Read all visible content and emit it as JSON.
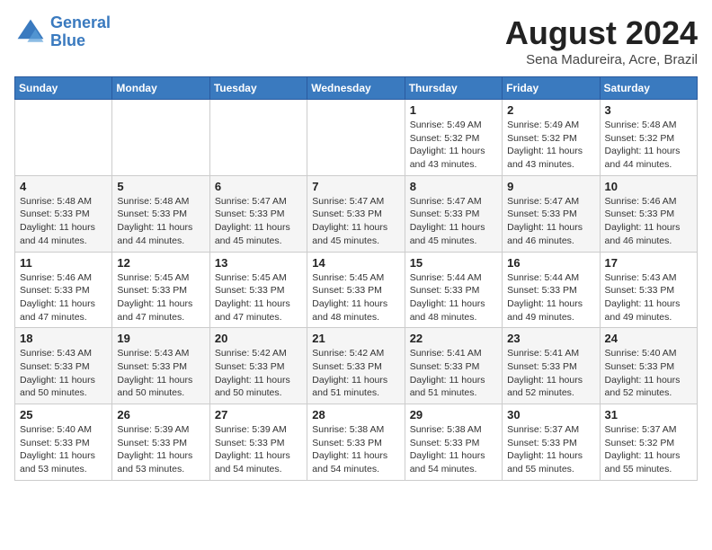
{
  "logo": {
    "line1": "General",
    "line2": "Blue"
  },
  "title": "August 2024",
  "location": "Sena Madureira, Acre, Brazil",
  "days_of_week": [
    "Sunday",
    "Monday",
    "Tuesday",
    "Wednesday",
    "Thursday",
    "Friday",
    "Saturday"
  ],
  "weeks": [
    [
      {
        "day": "",
        "info": ""
      },
      {
        "day": "",
        "info": ""
      },
      {
        "day": "",
        "info": ""
      },
      {
        "day": "",
        "info": ""
      },
      {
        "day": "1",
        "info": "Sunrise: 5:49 AM\nSunset: 5:32 PM\nDaylight: 11 hours and 43 minutes."
      },
      {
        "day": "2",
        "info": "Sunrise: 5:49 AM\nSunset: 5:32 PM\nDaylight: 11 hours and 43 minutes."
      },
      {
        "day": "3",
        "info": "Sunrise: 5:48 AM\nSunset: 5:32 PM\nDaylight: 11 hours and 44 minutes."
      }
    ],
    [
      {
        "day": "4",
        "info": "Sunrise: 5:48 AM\nSunset: 5:33 PM\nDaylight: 11 hours and 44 minutes."
      },
      {
        "day": "5",
        "info": "Sunrise: 5:48 AM\nSunset: 5:33 PM\nDaylight: 11 hours and 44 minutes."
      },
      {
        "day": "6",
        "info": "Sunrise: 5:47 AM\nSunset: 5:33 PM\nDaylight: 11 hours and 45 minutes."
      },
      {
        "day": "7",
        "info": "Sunrise: 5:47 AM\nSunset: 5:33 PM\nDaylight: 11 hours and 45 minutes."
      },
      {
        "day": "8",
        "info": "Sunrise: 5:47 AM\nSunset: 5:33 PM\nDaylight: 11 hours and 45 minutes."
      },
      {
        "day": "9",
        "info": "Sunrise: 5:47 AM\nSunset: 5:33 PM\nDaylight: 11 hours and 46 minutes."
      },
      {
        "day": "10",
        "info": "Sunrise: 5:46 AM\nSunset: 5:33 PM\nDaylight: 11 hours and 46 minutes."
      }
    ],
    [
      {
        "day": "11",
        "info": "Sunrise: 5:46 AM\nSunset: 5:33 PM\nDaylight: 11 hours and 47 minutes."
      },
      {
        "day": "12",
        "info": "Sunrise: 5:45 AM\nSunset: 5:33 PM\nDaylight: 11 hours and 47 minutes."
      },
      {
        "day": "13",
        "info": "Sunrise: 5:45 AM\nSunset: 5:33 PM\nDaylight: 11 hours and 47 minutes."
      },
      {
        "day": "14",
        "info": "Sunrise: 5:45 AM\nSunset: 5:33 PM\nDaylight: 11 hours and 48 minutes."
      },
      {
        "day": "15",
        "info": "Sunrise: 5:44 AM\nSunset: 5:33 PM\nDaylight: 11 hours and 48 minutes."
      },
      {
        "day": "16",
        "info": "Sunrise: 5:44 AM\nSunset: 5:33 PM\nDaylight: 11 hours and 49 minutes."
      },
      {
        "day": "17",
        "info": "Sunrise: 5:43 AM\nSunset: 5:33 PM\nDaylight: 11 hours and 49 minutes."
      }
    ],
    [
      {
        "day": "18",
        "info": "Sunrise: 5:43 AM\nSunset: 5:33 PM\nDaylight: 11 hours and 50 minutes."
      },
      {
        "day": "19",
        "info": "Sunrise: 5:43 AM\nSunset: 5:33 PM\nDaylight: 11 hours and 50 minutes."
      },
      {
        "day": "20",
        "info": "Sunrise: 5:42 AM\nSunset: 5:33 PM\nDaylight: 11 hours and 50 minutes."
      },
      {
        "day": "21",
        "info": "Sunrise: 5:42 AM\nSunset: 5:33 PM\nDaylight: 11 hours and 51 minutes."
      },
      {
        "day": "22",
        "info": "Sunrise: 5:41 AM\nSunset: 5:33 PM\nDaylight: 11 hours and 51 minutes."
      },
      {
        "day": "23",
        "info": "Sunrise: 5:41 AM\nSunset: 5:33 PM\nDaylight: 11 hours and 52 minutes."
      },
      {
        "day": "24",
        "info": "Sunrise: 5:40 AM\nSunset: 5:33 PM\nDaylight: 11 hours and 52 minutes."
      }
    ],
    [
      {
        "day": "25",
        "info": "Sunrise: 5:40 AM\nSunset: 5:33 PM\nDaylight: 11 hours and 53 minutes."
      },
      {
        "day": "26",
        "info": "Sunrise: 5:39 AM\nSunset: 5:33 PM\nDaylight: 11 hours and 53 minutes."
      },
      {
        "day": "27",
        "info": "Sunrise: 5:39 AM\nSunset: 5:33 PM\nDaylight: 11 hours and 54 minutes."
      },
      {
        "day": "28",
        "info": "Sunrise: 5:38 AM\nSunset: 5:33 PM\nDaylight: 11 hours and 54 minutes."
      },
      {
        "day": "29",
        "info": "Sunrise: 5:38 AM\nSunset: 5:33 PM\nDaylight: 11 hours and 54 minutes."
      },
      {
        "day": "30",
        "info": "Sunrise: 5:37 AM\nSunset: 5:33 PM\nDaylight: 11 hours and 55 minutes."
      },
      {
        "day": "31",
        "info": "Sunrise: 5:37 AM\nSunset: 5:32 PM\nDaylight: 11 hours and 55 minutes."
      }
    ]
  ]
}
